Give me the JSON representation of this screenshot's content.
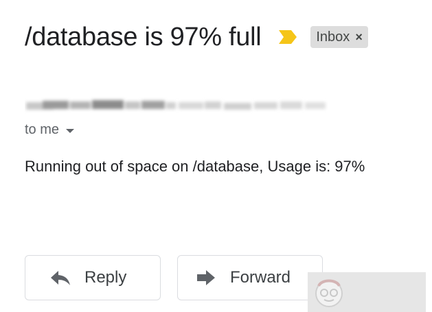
{
  "email": {
    "subject": "/database is 97% full",
    "label": "Inbox",
    "label_remove": "×",
    "recipient": "to me",
    "body": "Running out of space on /database, Usage is: 97%"
  },
  "actions": {
    "reply_label": "Reply",
    "forward_label": "Forward"
  },
  "icons": {
    "importance": "importance-marker-icon",
    "recipient_caret": "chevron-down-icon",
    "reply": "reply-arrow-icon",
    "forward": "forward-arrow-icon"
  },
  "colors": {
    "importance_marker": "#f5c518",
    "label_chip_bg": "#dddddd",
    "button_border": "#dadce0",
    "icon_gray": "#5f6368"
  }
}
